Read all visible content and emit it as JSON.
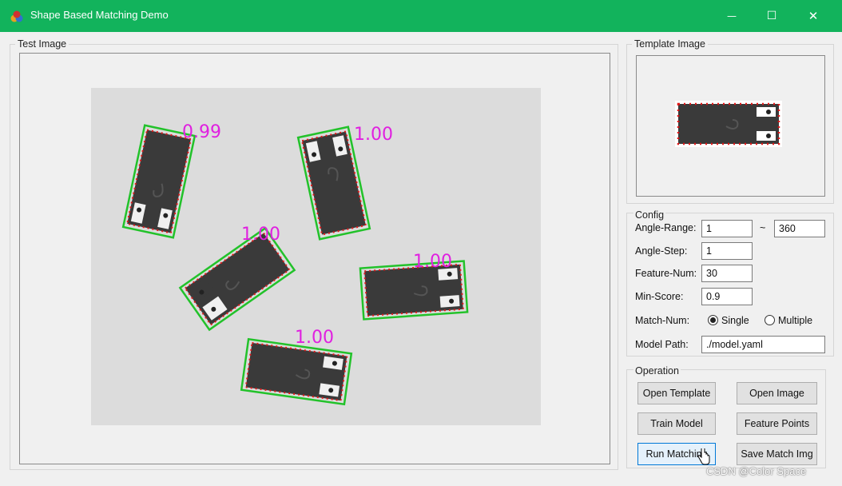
{
  "window": {
    "title": "Shape Based Matching Demo",
    "accent_color": "#12b35c",
    "controls": {
      "minimize_glyph": "—",
      "maximize_glyph": "☐",
      "close_glyph": "✕"
    }
  },
  "test_image": {
    "label": "Test Image",
    "scores": [
      "0.99",
      "1.00",
      "1.00",
      "1.00",
      "1.00"
    ],
    "box_color": "#22c22a",
    "feature_color": "#e01818",
    "score_color": "#e020e0"
  },
  "template_image": {
    "label": "Template Image"
  },
  "config": {
    "label": "Config",
    "angle_range": {
      "label": "Angle-Range:",
      "min": "1",
      "separator": "~",
      "max": "360"
    },
    "angle_step": {
      "label": "Angle-Step:",
      "value": "1"
    },
    "feature_num": {
      "label": "Feature-Num:",
      "value": "30"
    },
    "min_score": {
      "label": "Min-Score:",
      "value": "0.9"
    },
    "match_num": {
      "label": "Match-Num:",
      "options": [
        "Single",
        "Multiple"
      ],
      "selected": "Single"
    },
    "model_path": {
      "label": "Model Path:",
      "value": "./model.yaml"
    }
  },
  "operation": {
    "label": "Operation",
    "buttons": {
      "open_template": "Open Template",
      "open_image": "Open Image",
      "train_model": "Train Model",
      "feature_points": "Feature Points",
      "run_matching": "Run Matching",
      "save_match_img": "Save Match Img"
    }
  },
  "watermark": "CSDN @Color Space"
}
